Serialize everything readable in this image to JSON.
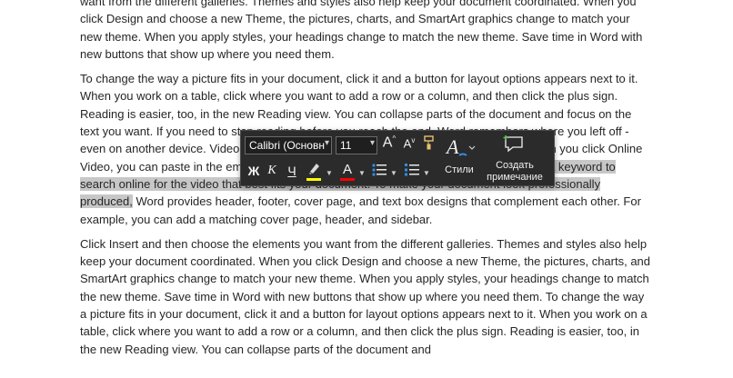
{
  "document": {
    "paragraphs": [
      "want from the different galleries. Themes and styles also help keep your document coordinated. When you click Design and choose a new Theme, the pictures, charts, and SmartArt graphics change to match your new theme. When you apply styles, your headings change to match the new theme. Save time in Word with new buttons that show up where you need them.",
      {
        "before": "To change the way a picture fits in your document, click it and a button for layout options appears next to it. When you work on a table, click where you want to add a row or a column, and then click the plus sign. Reading is easier, too, in the new Reading view. You can collapse parts of the document and focus on the text you want. If you need to stop reading before you reach the end, Word remembers where you left off - even on another device. Video provides a powerful way to help you prove your point. When you click Online Video, you can paste in the embed code for the video you want to add. You can also type ",
        "selected": "a keyword to search online for the video that best fits your document. To make your document look professionally produced,",
        "after": " Word provides header, footer, cover page, and text box designs that complement each other. For example, you can add a matching cover page, header, and sidebar."
      },
      "Click Insert and then choose the elements you want from the different galleries. Themes and styles also help keep your document coordinated. When you click Design and choose a new Theme, the pictures, charts, and SmartArt graphics change to match your new theme. When you apply styles, your headings change to match the new theme. Save time in Word with new buttons that show up where you need them. To change the way a picture fits in your document, click it and a button for layout options appears next to it. When you work on a table, click where you want to add a row or a column, and then click the plus sign. Reading is easier, too, in the new Reading view. You can collapse parts of the document and"
    ]
  },
  "mini_toolbar": {
    "font_name": "Calibri (Основн",
    "font_size": "11",
    "grow_font": "A",
    "shrink_font": "A",
    "bold": "Ж",
    "italic": "К",
    "underline": "Ч",
    "font_color_letter": "A",
    "styles_label": "Стили",
    "comment_label_line1": "Создать",
    "comment_label_line2": "примечание",
    "colors": {
      "highlight": "#ffff00",
      "font_color": "#ff0000"
    }
  }
}
